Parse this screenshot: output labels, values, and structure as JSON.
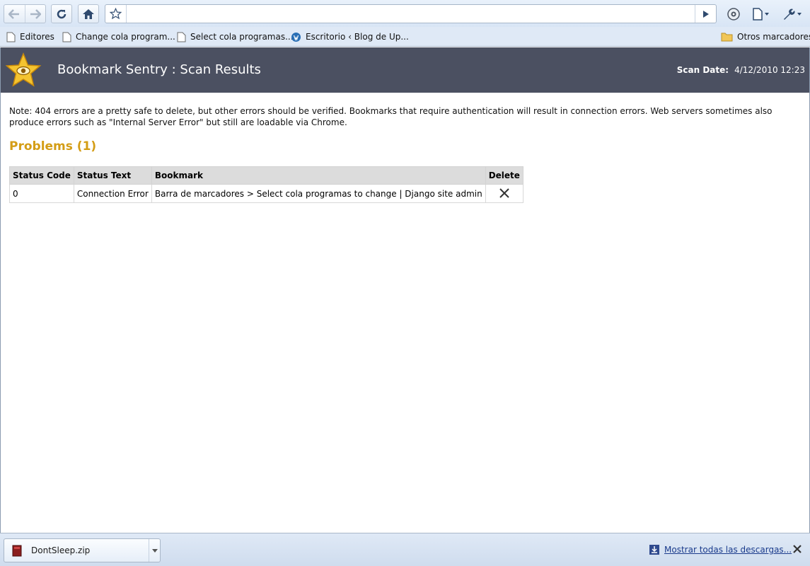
{
  "browser": {
    "address_value": "",
    "bookmarks": [
      {
        "label": "Editores",
        "icon": "folder-icon"
      },
      {
        "label": "Change cola program...",
        "icon": "page-icon"
      },
      {
        "label": "Select cola programas...",
        "icon": "page-icon"
      },
      {
        "label": "Escritorio ‹ Blog de Up...",
        "icon": "wordpress-icon"
      }
    ],
    "other_bookmarks": "Otros marcadores"
  },
  "page": {
    "title": "Bookmark Sentry : Scan Results",
    "scan_label": "Scan Date:",
    "scan_value": "4/12/2010 12:23",
    "note": "Note: 404 errors are a pretty safe to delete, but other errors should be verified. Bookmarks that require authentication will result in connection errors. Web servers sometimes also produce errors such as \"Internal Server Error\" but still are loadable via Chrome.",
    "problems_heading": "Problems (1)",
    "table": {
      "headers": [
        "Status Code",
        "Status Text",
        "Bookmark",
        "Delete"
      ],
      "rows": [
        {
          "code": "0",
          "text": "Connection Error",
          "bookmark": "Barra de marcadores > Select cola programas to change | Django site admin"
        }
      ]
    }
  },
  "downloads": {
    "file_name": "DontSleep.zip",
    "show_all": "Mostrar todas las descargas..."
  },
  "colors": {
    "header_bg": "#4b5061",
    "accent": "#d49d16"
  }
}
